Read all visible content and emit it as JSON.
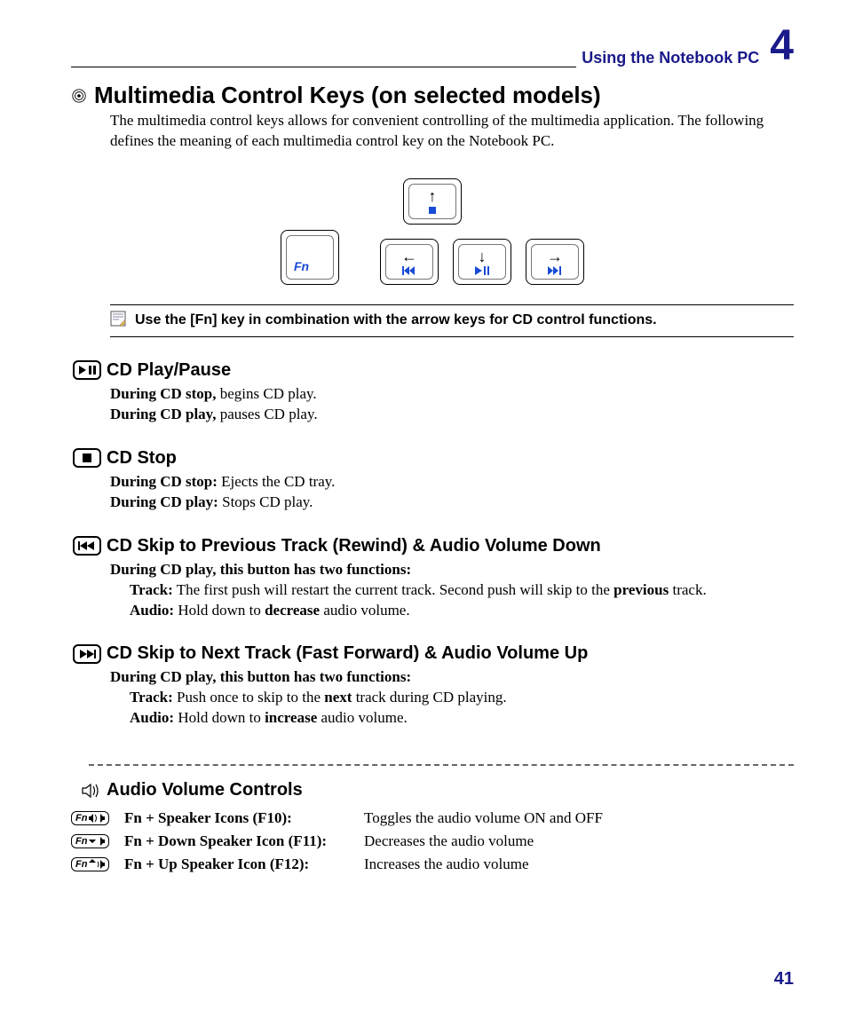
{
  "header": {
    "chapter_title": "Using the Notebook PC",
    "chapter_number": "4"
  },
  "section": {
    "title": "Multimedia Control Keys (on selected models)",
    "intro": "The multimedia control keys allows for convenient controlling of the multimedia application. The following defines the meaning of each multimedia control key on the Notebook PC."
  },
  "fn_key_label": "Fn",
  "note": "Use the [Fn] key in combination with the arrow keys for CD control functions.",
  "subsections": {
    "play": {
      "title": "CD Play/Pause",
      "line1_b": "During CD stop,",
      "line1_t": " begins CD play.",
      "line2_b": "During CD play,",
      "line2_t": " pauses CD play."
    },
    "stop": {
      "title": "CD Stop",
      "line1_b": "During CD stop:",
      "line1_t": " Ejects the CD tray.",
      "line2_b": "During CD play:",
      "line2_t": " Stops CD play."
    },
    "prev": {
      "title": "CD Skip to Previous Track (Rewind) & Audio Volume Down",
      "intro": "During CD play, this button has two functions:",
      "track_b": "Track:",
      "track_t1": " The first push will restart the current track. Second push will skip to the ",
      "track_em": "previous",
      "track_t2": " track.",
      "audio_b": "Audio:",
      "audio_t1": " Hold down to ",
      "audio_em": "decrease",
      "audio_t2": " audio volume."
    },
    "next": {
      "title": "CD Skip to Next Track (Fast Forward) & Audio Volume Up",
      "intro": "During CD play, this button has two functions:",
      "track_b": "Track:",
      "track_t1": " Push once to skip to the ",
      "track_em": "next",
      "track_t2": " track during CD playing.",
      "audio_b": "Audio:",
      "audio_t1": " Hold down to ",
      "audio_em": "increase",
      "audio_t2": " audio volume."
    }
  },
  "audio_section": {
    "title": "Audio Volume Controls",
    "rows": [
      {
        "label": "Fn + Speaker Icons (F10):",
        "desc": "Toggles the audio volume ON and OFF"
      },
      {
        "label": "Fn + Down Speaker Icon (F11):",
        "desc": "Decreases the audio volume"
      },
      {
        "label": "Fn + Up Speaker Icon (F12):",
        "desc": "Increases the audio volume"
      }
    ]
  },
  "page_number": "41"
}
